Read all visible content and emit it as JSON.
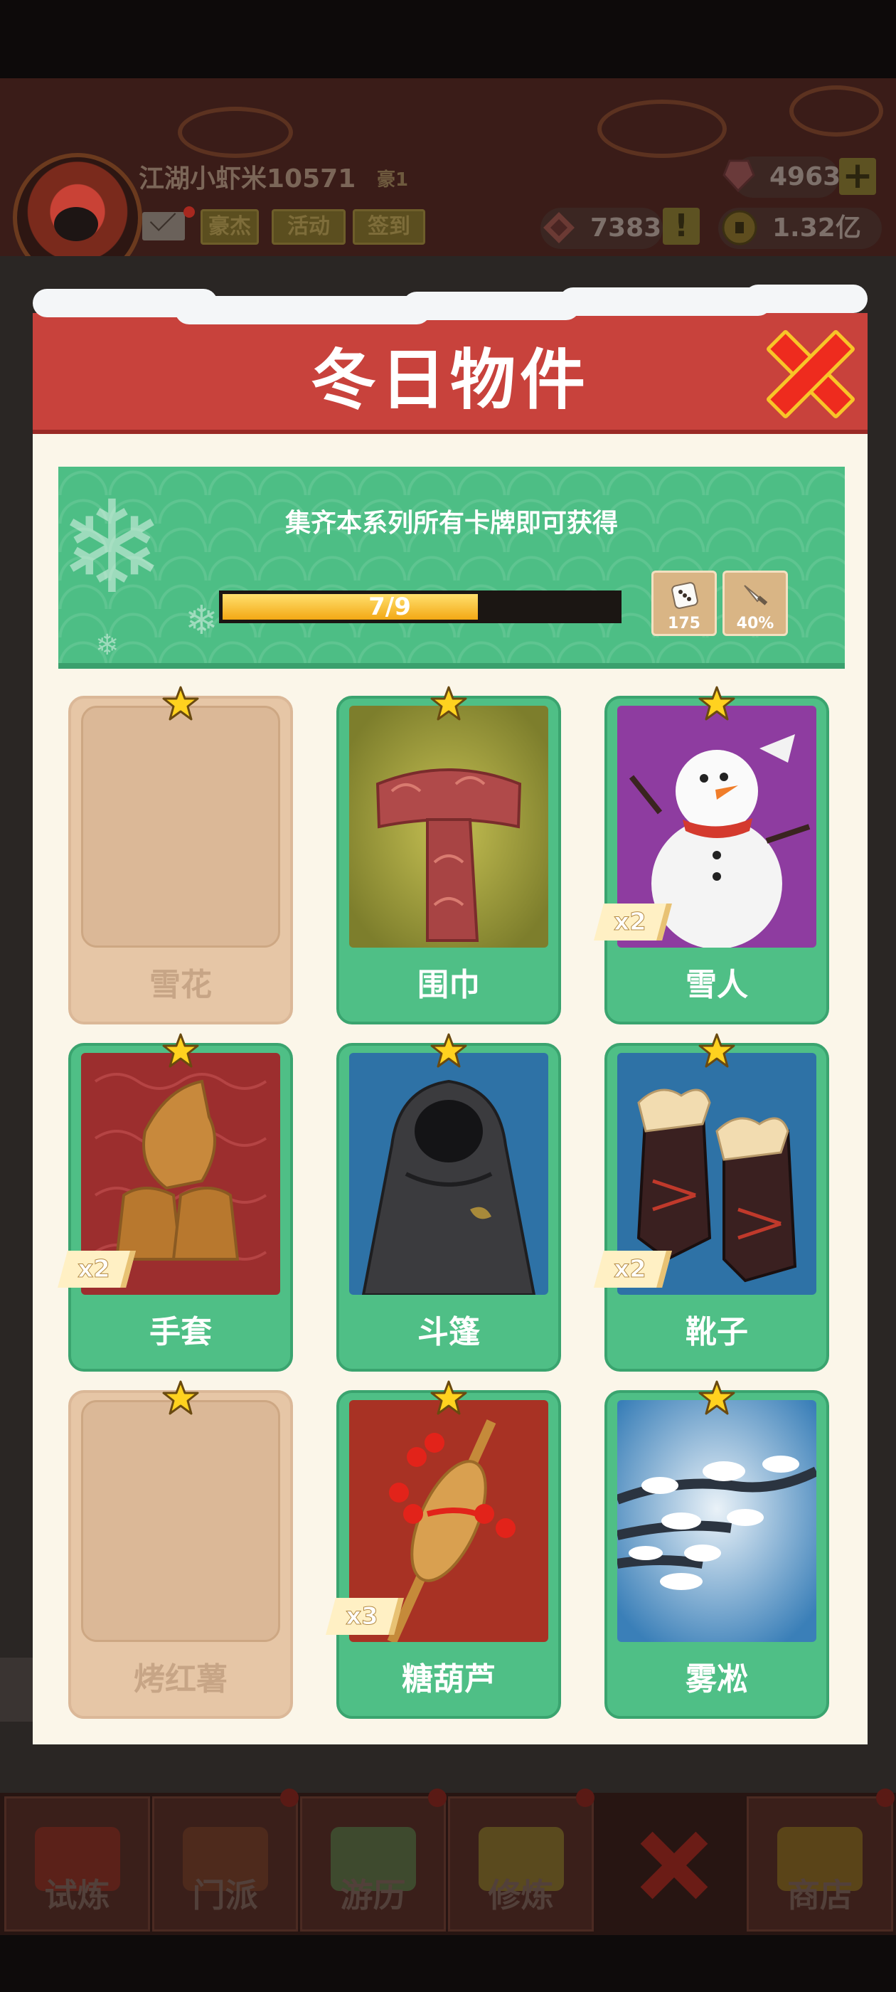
{
  "header": {
    "player_name": "江湖小虾米10571",
    "rank_tag": "豪1",
    "buttons": [
      "豪杰",
      "活动",
      "签到"
    ],
    "gems": "4963",
    "tokens": "7383",
    "coins": "1.32亿",
    "plus_label": "+",
    "warn_label": "!"
  },
  "modal": {
    "title": "冬日物件",
    "banner_text": "集齐本系列所有卡牌即可获得",
    "progress": {
      "label": "7/9",
      "value": 7,
      "max": 9
    },
    "rewards": [
      {
        "icon": "dice-icon",
        "value": "175"
      },
      {
        "icon": "dagger-icon",
        "value": "40%"
      }
    ],
    "cards": [
      {
        "name": "雪花",
        "owned": false,
        "count": "",
        "art": "locked"
      },
      {
        "name": "围巾",
        "owned": true,
        "count": "",
        "art": "scarf"
      },
      {
        "name": "雪人",
        "owned": true,
        "count": "x2",
        "art": "snowman"
      },
      {
        "name": "手套",
        "owned": true,
        "count": "x2",
        "art": "gloves"
      },
      {
        "name": "斗篷",
        "owned": true,
        "count": "",
        "art": "cloak"
      },
      {
        "name": "靴子",
        "owned": true,
        "count": "x2",
        "art": "boots"
      },
      {
        "name": "烤红薯",
        "owned": false,
        "count": "",
        "art": "locked"
      },
      {
        "name": "糖葫芦",
        "owned": true,
        "count": "x3",
        "art": "candied-haws"
      },
      {
        "name": "雾凇",
        "owned": true,
        "count": "",
        "art": "rime"
      }
    ]
  },
  "nav": {
    "tabs": [
      "试炼",
      "门派",
      "游历",
      "修炼",
      "商店"
    ]
  },
  "colors": {
    "title_red": "#c8423c",
    "banner_green": "#4dbe85",
    "card_green": "#4fbf86",
    "close_red": "#ee2b1e",
    "progress_yellow": "#f3a814"
  }
}
